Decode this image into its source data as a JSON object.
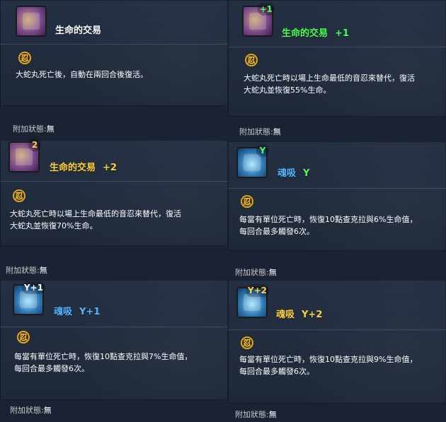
{
  "left": {
    "card1": {
      "title": "生命的交易",
      "desc": "大蛇丸死亡後，自動在兩回合後復活。"
    },
    "status1": {
      "label": "附加狀態",
      "colon": ":",
      "value": "無"
    },
    "card2": {
      "badge": "2",
      "title": "生命的交易",
      "level": "+2",
      "desc_lines": [
        "大蛇丸死亡時以場上生命最低的音忍來替代，復活",
        "大蛇丸並恢復70%生命。"
      ]
    },
    "status2": {
      "label": "附加狀態",
      "colon": ":",
      "value": "無"
    },
    "card3": {
      "badge": "Y+1",
      "title": "魂吸",
      "level": "Y+1",
      "desc_lines": [
        "每當有單位死亡時，恢復10點查克拉與7%生命值，",
        "每回合最多觸發6次。"
      ]
    },
    "status3": {
      "label": "附加狀態",
      "colon": ":",
      "value": "無"
    }
  },
  "right": {
    "card1": {
      "badge": "+1",
      "title": "生命的交易",
      "level": "+1",
      "desc_lines": [
        "大蛇丸死亡時以場上生命最低的音忍來替代，復活",
        "大蛇丸並恢復55%生命。"
      ]
    },
    "status1": {
      "label": "附加狀態",
      "colon": ":",
      "value": "無"
    },
    "card2": {
      "badge": "Y",
      "title": "魂吸",
      "level": "Y",
      "desc_lines": [
        "每當有單位死亡時，恢復10點查克拉與6%生命值，",
        "每回合最多觸發6次。"
      ]
    },
    "status2": {
      "label": "附加狀態",
      "colon": ":",
      "value": "無"
    },
    "card3": {
      "badge": "Y+2",
      "title": "魂吸",
      "level": "Y+2",
      "desc_lines": [
        "每當有單位死亡時，恢復10點查克拉與9%生命值，",
        "每回合最多觸發6次。"
      ]
    },
    "status3": {
      "label": "附加狀態",
      "colon": ":",
      "value": "無"
    }
  },
  "icons": {
    "ninja_glyph": "忍"
  },
  "colors": {
    "title_white": "#ffffff",
    "plus1_green": "#4cff56",
    "plus2_orange": "#ffd23a",
    "y1_blue": "#55b6ff",
    "ninja_gold": "#e1a91a"
  }
}
